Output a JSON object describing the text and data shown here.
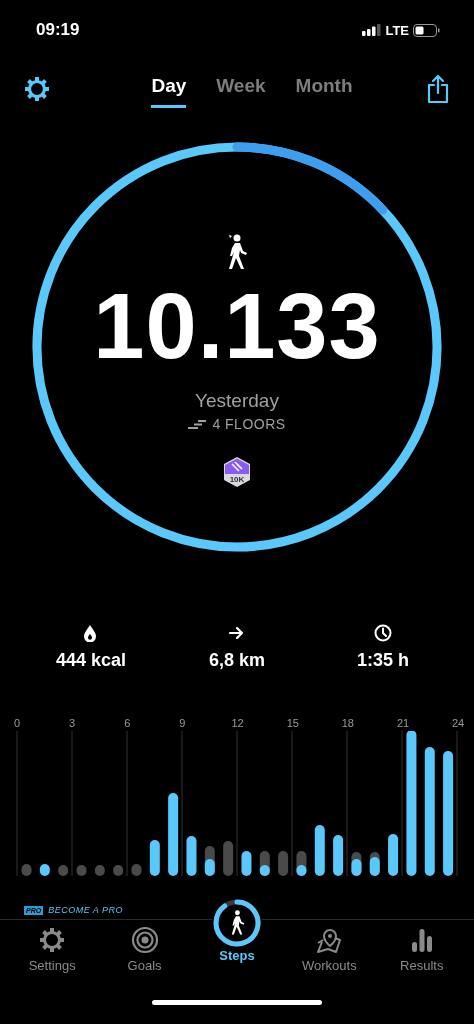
{
  "status_bar": {
    "time": "09:19",
    "network": "LTE"
  },
  "tabs": [
    {
      "label": "Day",
      "selected": true
    },
    {
      "label": "Week",
      "selected": false
    },
    {
      "label": "Month",
      "selected": false
    }
  ],
  "summary": {
    "steps": "10.133",
    "day": "Yesterday",
    "floors": "4 FLOORS",
    "badge": "10K"
  },
  "stats": [
    {
      "kind": "calories",
      "value": "444 kcal"
    },
    {
      "kind": "distance",
      "value": "6,8 km"
    },
    {
      "kind": "duration",
      "value": "1:35 h"
    }
  ],
  "hour_labels": [
    "0",
    "3",
    "6",
    "9",
    "12",
    "15",
    "18",
    "21",
    "24"
  ],
  "promo": {
    "badge": "PRO",
    "text": "BECOME A PRO"
  },
  "nav": [
    {
      "kind": "settings",
      "label": "Settings",
      "selected": false
    },
    {
      "kind": "goals",
      "label": "Goals",
      "selected": false
    },
    {
      "kind": "steps",
      "label": "Steps",
      "selected": true
    },
    {
      "kind": "workouts",
      "label": "Workouts",
      "selected": false
    },
    {
      "kind": "results",
      "label": "Results",
      "selected": false
    }
  ]
}
